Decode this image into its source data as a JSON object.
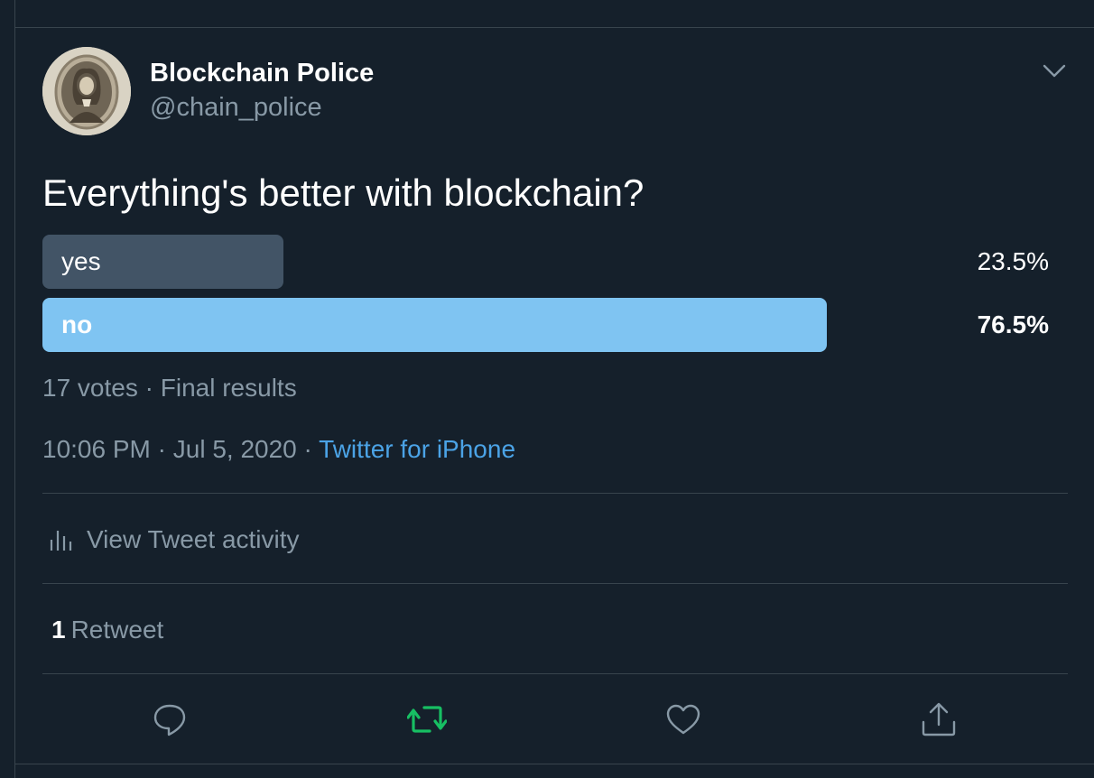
{
  "author": {
    "display_name": "Blockchain Police",
    "handle": "@chain_police",
    "avatar_icon": "portrait-engraving-avatar"
  },
  "tweet": {
    "text": "Everything's better with blockchain?"
  },
  "poll": {
    "options": [
      {
        "label": "yes",
        "percent_label": "23.5%",
        "fraction": 0.235,
        "winner": false,
        "color": "#425466"
      },
      {
        "label": "no",
        "percent_label": "76.5%",
        "fraction": 0.765,
        "winner": true,
        "color": "#7fc4f2"
      }
    ],
    "votes": "17 votes",
    "separator": "·",
    "status": "Final results"
  },
  "meta": {
    "time": "10:06 PM",
    "separator": "·",
    "date": "Jul 5, 2020",
    "source": "Twitter for iPhone"
  },
  "activity": {
    "label": "View Tweet activity",
    "icon": "bar-chart-icon"
  },
  "stats": {
    "retweet_count": "1",
    "retweet_label": "Retweet"
  },
  "actions": {
    "reply_icon": "reply-icon",
    "retweet_icon": "retweet-icon",
    "like_icon": "heart-icon",
    "share_icon": "share-icon"
  },
  "colors": {
    "background": "#15202b",
    "border": "#38444d",
    "secondary_text": "#8899a6",
    "link": "#4ba3e6",
    "retweet_active": "#17bf63"
  }
}
